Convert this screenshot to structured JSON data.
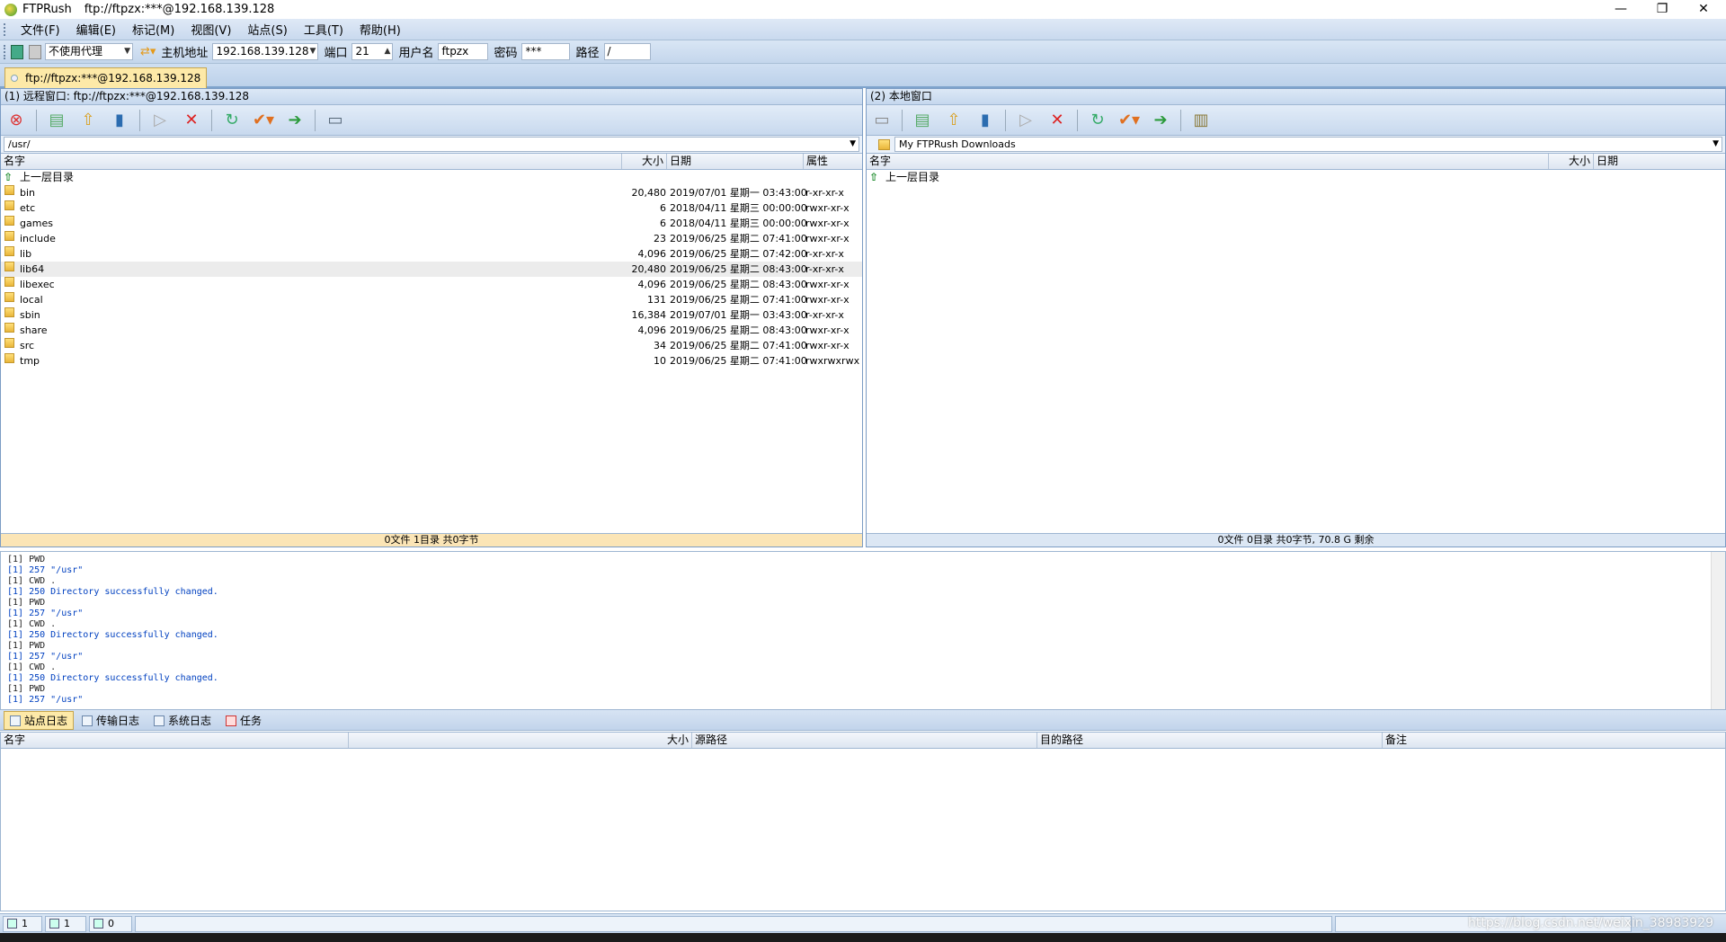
{
  "window": {
    "app_name": "FTPRush",
    "subtitle": "ftp://ftpzx:***@192.168.139.128",
    "min": "—",
    "restore": "❐",
    "close": "✕"
  },
  "menu": [
    "文件(F)",
    "编辑(E)",
    "标记(M)",
    "视图(V)",
    "站点(S)",
    "工具(T)",
    "帮助(H)"
  ],
  "address_bar": {
    "proxy": "不使用代理",
    "host_label": "主机地址",
    "host": "192.168.139.128",
    "port_label": "端口",
    "port": "21",
    "user_label": "用户名",
    "user": "ftpzx",
    "pass_label": "密码",
    "pass": "***",
    "path_label": "路径",
    "path": "/"
  },
  "session_tab": "ftp://ftpzx:***@192.168.139.128",
  "remote": {
    "header": "(1) 远程窗口: ftp://ftpzx:***@192.168.139.128",
    "path": "/usr/",
    "columns": [
      "名字",
      "大小",
      "日期",
      "属性"
    ],
    "parent": "上一层目录",
    "rows": [
      {
        "name": "bin",
        "size": "20,480",
        "date": "2019/07/01 星期一 03:43:00",
        "attr": "r-xr-xr-x"
      },
      {
        "name": "etc",
        "size": "6",
        "date": "2018/04/11 星期三 00:00:00",
        "attr": "rwxr-xr-x"
      },
      {
        "name": "games",
        "size": "6",
        "date": "2018/04/11 星期三 00:00:00",
        "attr": "rwxr-xr-x"
      },
      {
        "name": "include",
        "size": "23",
        "date": "2019/06/25 星期二 07:41:00",
        "attr": "rwxr-xr-x"
      },
      {
        "name": "lib",
        "size": "4,096",
        "date": "2019/06/25 星期二 07:42:00",
        "attr": "r-xr-xr-x"
      },
      {
        "name": "lib64",
        "size": "20,480",
        "date": "2019/06/25 星期二 08:43:00",
        "attr": "r-xr-xr-x"
      },
      {
        "name": "libexec",
        "size": "4,096",
        "date": "2019/06/25 星期二 08:43:00",
        "attr": "rwxr-xr-x"
      },
      {
        "name": "local",
        "size": "131",
        "date": "2019/06/25 星期二 07:41:00",
        "attr": "rwxr-xr-x"
      },
      {
        "name": "sbin",
        "size": "16,384",
        "date": "2019/07/01 星期一 03:43:00",
        "attr": "r-xr-xr-x"
      },
      {
        "name": "share",
        "size": "4,096",
        "date": "2019/06/25 星期二 08:43:00",
        "attr": "rwxr-xr-x"
      },
      {
        "name": "src",
        "size": "34",
        "date": "2019/06/25 星期二 07:41:00",
        "attr": "rwxr-xr-x"
      },
      {
        "name": "tmp",
        "size": "10",
        "date": "2019/06/25 星期二 07:41:00",
        "attr": "rwxrwxrwx"
      }
    ],
    "status": "0文件 1目录 共0字节"
  },
  "local": {
    "header": "(2) 本地窗口",
    "path": "My FTPRush Downloads",
    "columns": [
      "名字",
      "大小",
      "日期"
    ],
    "parent": "上一层目录",
    "status": "0文件 0目录 共0字节, 70.8 G 剩余"
  },
  "log": [
    {
      "text": "[1] PWD",
      "kind": "cmd"
    },
    {
      "text": "[1] 257 \"/usr\"",
      "kind": "resp"
    },
    {
      "text": "[1] CWD .",
      "kind": "cmd"
    },
    {
      "text": "[1] 250 Directory successfully changed.",
      "kind": "resp"
    },
    {
      "text": "[1] PWD",
      "kind": "cmd"
    },
    {
      "text": "[1] 257 \"/usr\"",
      "kind": "resp"
    },
    {
      "text": "[1] CWD .",
      "kind": "cmd"
    },
    {
      "text": "[1] 250 Directory successfully changed.",
      "kind": "resp"
    },
    {
      "text": "[1] PWD",
      "kind": "cmd"
    },
    {
      "text": "[1] 257 \"/usr\"",
      "kind": "resp"
    },
    {
      "text": "[1] CWD .",
      "kind": "cmd"
    },
    {
      "text": "[1] 250 Directory successfully changed.",
      "kind": "resp"
    },
    {
      "text": "[1] PWD",
      "kind": "cmd"
    },
    {
      "text": "[1] 257 \"/usr\"",
      "kind": "resp"
    }
  ],
  "log_tabs": [
    "站点日志",
    "传输日志",
    "系统日志",
    "任务"
  ],
  "queue_columns": [
    "名字",
    "大小",
    "源路径",
    "目的路径",
    "备注"
  ],
  "bottom_status": [
    "1",
    "1",
    "0"
  ],
  "watermark": "https://blog.csdn.net/weixin_38983929"
}
